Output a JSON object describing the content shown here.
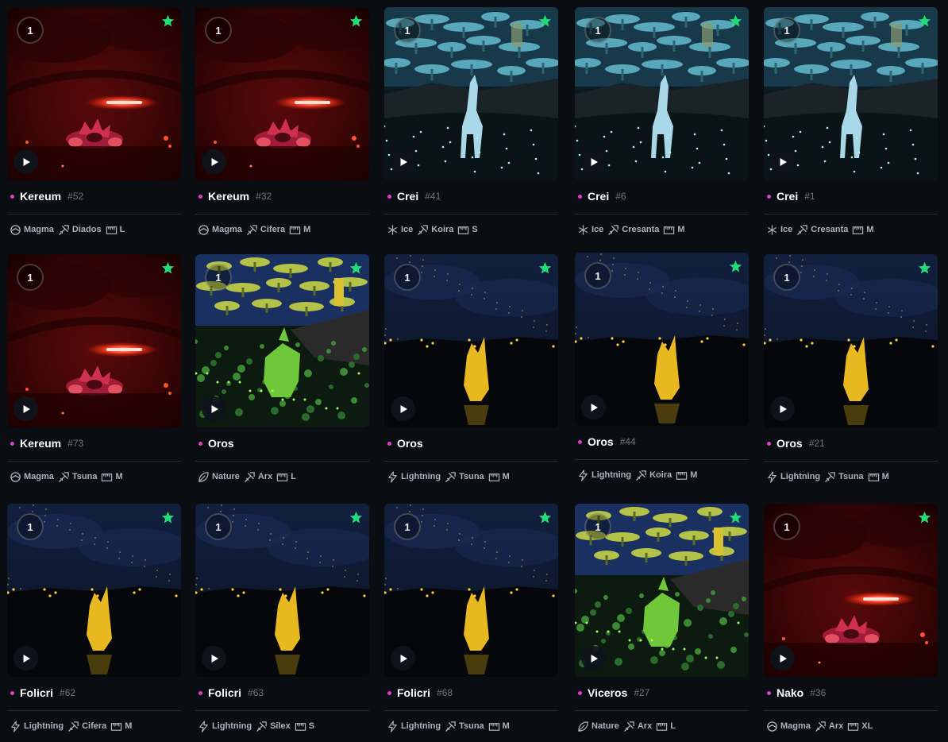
{
  "colors": {
    "background": "#0a0d12",
    "rarity_dot": "#e040c8",
    "favorite_star": "#22dd77",
    "name": "#ffffff",
    "number": "#6d7784",
    "trait_text": "#aab4c0"
  },
  "cards": [
    {
      "name": "Kereum",
      "number": "#52",
      "count": "1",
      "favorite": true,
      "scene": "magma-creature",
      "element": "Magma",
      "element_icon": "magma-icon",
      "class": "Diados",
      "size": "L"
    },
    {
      "name": "Kereum",
      "number": "#32",
      "count": "1",
      "favorite": true,
      "scene": "magma-creature",
      "element": "Magma",
      "element_icon": "magma-icon",
      "class": "Cifera",
      "size": "M"
    },
    {
      "name": "Crei",
      "number": "#41",
      "count": "1",
      "favorite": true,
      "scene": "ice-creature",
      "element": "Ice",
      "element_icon": "snowflake-icon",
      "class": "Koira",
      "size": "S"
    },
    {
      "name": "Crei",
      "number": "#6",
      "count": "1",
      "favorite": true,
      "scene": "ice-creature",
      "element": "Ice",
      "element_icon": "snowflake-icon",
      "class": "Cresanta",
      "size": "M"
    },
    {
      "name": "Crei",
      "number": "#1",
      "count": "1",
      "favorite": true,
      "scene": "ice-creature",
      "element": "Ice",
      "element_icon": "snowflake-icon",
      "class": "Cresanta",
      "size": "M"
    },
    {
      "name": "Kereum",
      "number": "#73",
      "count": "1",
      "favorite": true,
      "scene": "magma-creature",
      "element": "Magma",
      "element_icon": "magma-icon",
      "class": "Tsuna",
      "size": "M"
    },
    {
      "name": "Oros",
      "number": "",
      "count": "1",
      "favorite": true,
      "scene": "nature-creature",
      "element": "Nature",
      "element_icon": "leaf-icon",
      "class": "Arx",
      "size": "L"
    },
    {
      "name": "Oros",
      "number": "",
      "count": "1",
      "favorite": true,
      "scene": "lightning-creature",
      "element": "Lightning",
      "element_icon": "lightning-icon",
      "class": "Tsuna",
      "size": "M"
    },
    {
      "name": "Oros",
      "number": "#44",
      "count": "1",
      "favorite": true,
      "scene": "lightning-creature",
      "element": "Lightning",
      "element_icon": "lightning-icon",
      "class": "Koira",
      "size": "M"
    },
    {
      "name": "Oros",
      "number": "#21",
      "count": "1",
      "favorite": true,
      "scene": "lightning-creature",
      "element": "Lightning",
      "element_icon": "lightning-icon",
      "class": "Tsuna",
      "size": "M"
    },
    {
      "name": "Folicri",
      "number": "#62",
      "count": "1",
      "favorite": true,
      "scene": "lightning-creature",
      "element": "Lightning",
      "element_icon": "lightning-icon",
      "class": "Cifera",
      "size": "M"
    },
    {
      "name": "Folicri",
      "number": "#63",
      "count": "1",
      "favorite": true,
      "scene": "lightning-creature",
      "element": "Lightning",
      "element_icon": "lightning-icon",
      "class": "Silex",
      "size": "S"
    },
    {
      "name": "Folicri",
      "number": "#68",
      "count": "1",
      "favorite": true,
      "scene": "lightning-creature",
      "element": "Lightning",
      "element_icon": "lightning-icon",
      "class": "Tsuna",
      "size": "M"
    },
    {
      "name": "Viceros",
      "number": "#27",
      "count": "1",
      "favorite": true,
      "scene": "nature-creature",
      "element": "Nature",
      "element_icon": "leaf-icon",
      "class": "Arx",
      "size": "L"
    },
    {
      "name": "Nako",
      "number": "#36",
      "count": "1",
      "favorite": true,
      "scene": "magma-creature",
      "element": "Magma",
      "element_icon": "magma-icon",
      "class": "Arx",
      "size": "XL"
    }
  ]
}
